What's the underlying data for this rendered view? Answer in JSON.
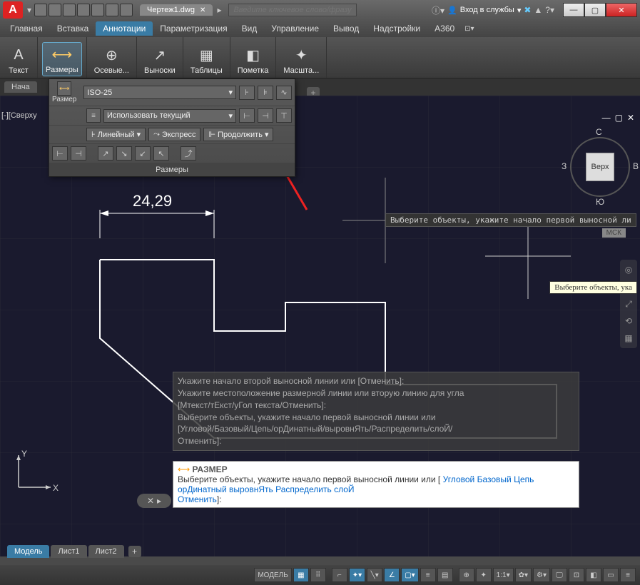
{
  "app_logo": "A",
  "title_tab": "Чертеж1.dwg",
  "search_placeholder": "Введите ключевое слово/фразу",
  "signin_label": "Вход в службы",
  "menu": {
    "items": [
      "Главная",
      "Вставка",
      "Аннотации",
      "Параметризация",
      "Вид",
      "Управление",
      "Вывод",
      "Надстройки",
      "A360"
    ],
    "active": 2
  },
  "ribbon": {
    "panels": [
      {
        "label": "Текст",
        "icon": "A"
      },
      {
        "label": "Размеры",
        "icon": "⟷",
        "active": true
      },
      {
        "label": "Осевые...",
        "icon": "⊕"
      },
      {
        "label": "Выноски",
        "icon": "↗"
      },
      {
        "label": "Таблицы",
        "icon": "▦"
      },
      {
        "label": "Пометка",
        "icon": "◧"
      },
      {
        "label": "Масшта...",
        "icon": "✦"
      }
    ]
  },
  "doc_tab": "Нача",
  "side_label": "[-][Сверху",
  "dropdown": {
    "row1_label": "Размер",
    "style_select": "ISO-25",
    "row2_select": "Использовать текущий",
    "row3_btn1": "Линейный",
    "row3_btn2": "Экспресс",
    "row3_btn3": "Продолжить",
    "footer": "Размеры"
  },
  "dimension_value": "24,29",
  "viewcube": {
    "center": "Верх",
    "n": "С",
    "s": "Ю",
    "e": "В",
    "w": "З"
  },
  "mck": "МСК",
  "cmd_tooltip1": "Выберите объекты, укажите начало первой выносной ли",
  "cmd_tooltip2": "Выберите объекты, ука",
  "cmd_history": {
    "l1": "Укажите начало второй выносной линии или [Отменить]:",
    "l2": "Укажите местоположение размерной линии или вторую линию для угла",
    "l3": "[Мтекст/тЕкст/уГол текста/Отменить]:",
    "l4": "Выберите объекты, укажите начало первой выносной линии или",
    "l5": "[Угловой/Базовый/Цепь/орДинатный/выровнЯть/Распределить/слоЙ/",
    "l6": "Отменить]:"
  },
  "cmd_input": {
    "name": "РАЗМЕР",
    "prompt": "Выберите объекты, укажите начало первой выносной линии или [",
    "opts": [
      "Угловой",
      "Базовый",
      "Цепь",
      "орДинатный",
      "выровнЯть",
      "Распределить",
      "слоЙ",
      "Отменить"
    ],
    "close": "]:"
  },
  "ucs": {
    "x": "X",
    "y": "Y"
  },
  "layout_tabs": {
    "items": [
      "Модель",
      "Лист1",
      "Лист2"
    ],
    "active": 0
  },
  "status": {
    "model": "МОДЕЛЬ",
    "scale": "1:1"
  }
}
